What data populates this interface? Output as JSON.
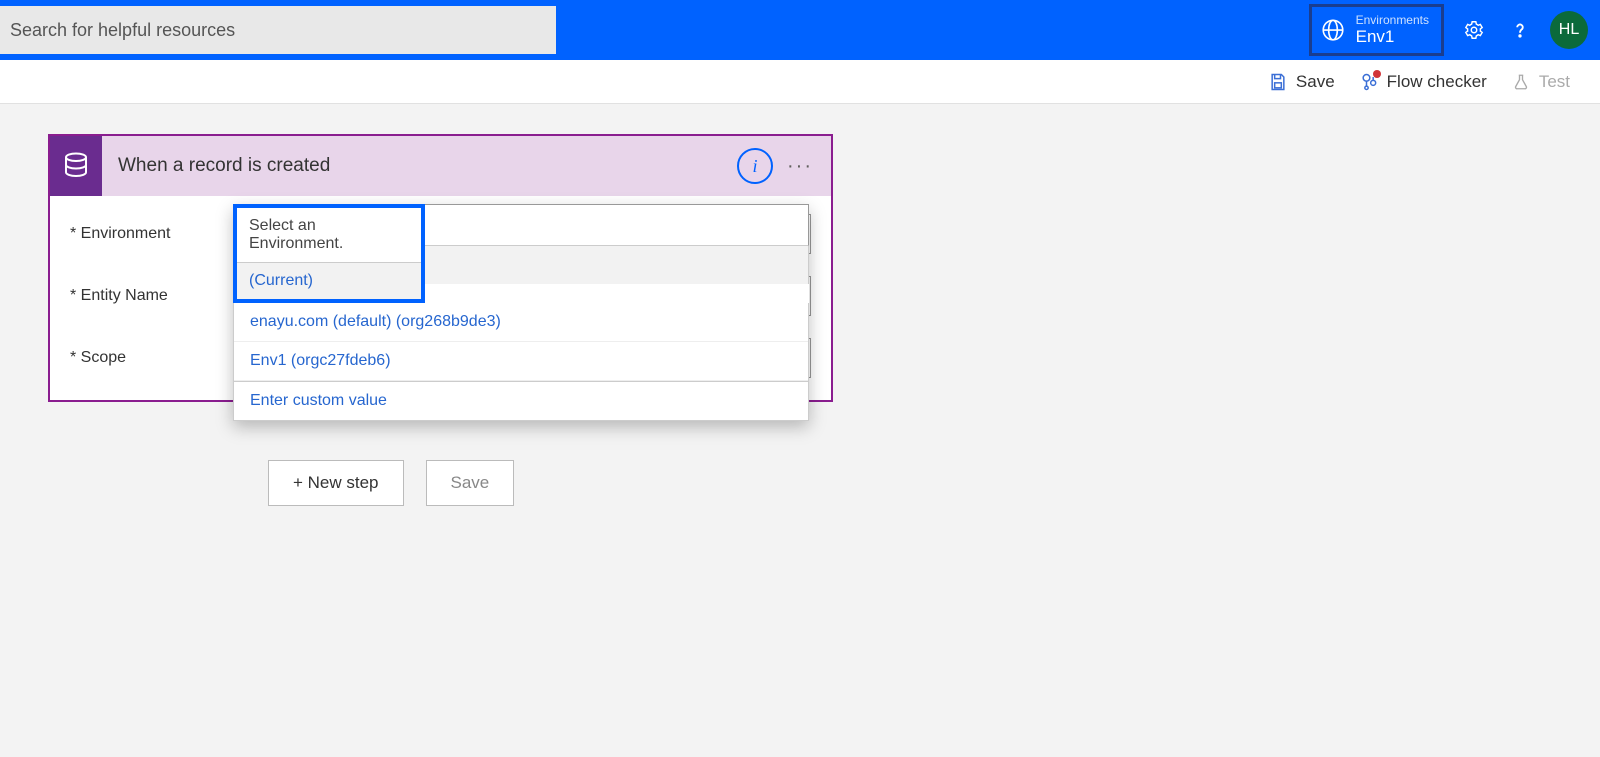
{
  "header": {
    "search_placeholder": "Search for helpful resources",
    "env_label": "Environments",
    "env_name": "Env1",
    "avatar_initials": "HL"
  },
  "toolbar": {
    "save": "Save",
    "flow_checker": "Flow checker",
    "test": "Test"
  },
  "trigger": {
    "title": "When a record is created",
    "fields": {
      "environment": "Environment",
      "entity_name": "Entity Name",
      "scope": "Scope"
    }
  },
  "dropdown": {
    "selected": "Select an Environment.",
    "options": [
      "(Current)",
      "enayu.com (default) (org268b9de3)",
      "Env1 (orgc27fdeb6)"
    ],
    "custom": "Enter custom value"
  },
  "actions": {
    "new_step": "+ New step",
    "save": "Save"
  }
}
